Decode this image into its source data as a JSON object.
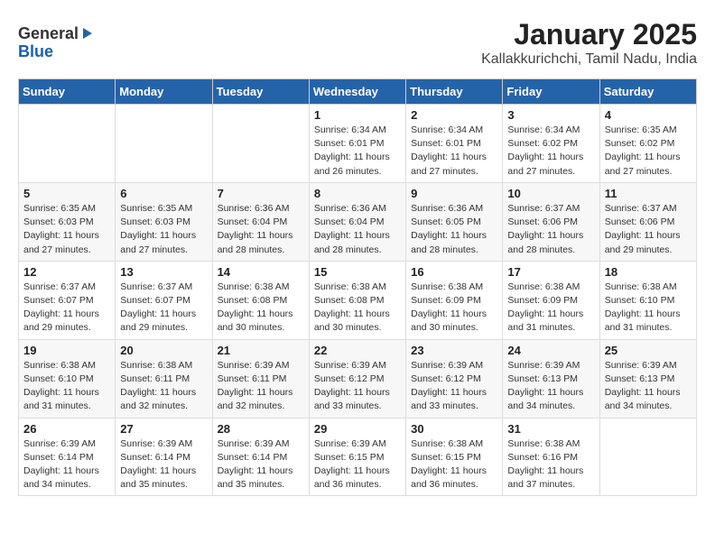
{
  "logo": {
    "general": "General",
    "blue": "Blue"
  },
  "header": {
    "title": "January 2025",
    "subtitle": "Kallakkurichchi, Tamil Nadu, India"
  },
  "weekdays": [
    "Sunday",
    "Monday",
    "Tuesday",
    "Wednesday",
    "Thursday",
    "Friday",
    "Saturday"
  ],
  "weeks": [
    [
      {
        "day": "",
        "info": ""
      },
      {
        "day": "",
        "info": ""
      },
      {
        "day": "",
        "info": ""
      },
      {
        "day": "1",
        "info": "Sunrise: 6:34 AM\nSunset: 6:01 PM\nDaylight: 11 hours\nand 26 minutes."
      },
      {
        "day": "2",
        "info": "Sunrise: 6:34 AM\nSunset: 6:01 PM\nDaylight: 11 hours\nand 27 minutes."
      },
      {
        "day": "3",
        "info": "Sunrise: 6:34 AM\nSunset: 6:02 PM\nDaylight: 11 hours\nand 27 minutes."
      },
      {
        "day": "4",
        "info": "Sunrise: 6:35 AM\nSunset: 6:02 PM\nDaylight: 11 hours\nand 27 minutes."
      }
    ],
    [
      {
        "day": "5",
        "info": "Sunrise: 6:35 AM\nSunset: 6:03 PM\nDaylight: 11 hours\nand 27 minutes."
      },
      {
        "day": "6",
        "info": "Sunrise: 6:35 AM\nSunset: 6:03 PM\nDaylight: 11 hours\nand 27 minutes."
      },
      {
        "day": "7",
        "info": "Sunrise: 6:36 AM\nSunset: 6:04 PM\nDaylight: 11 hours\nand 28 minutes."
      },
      {
        "day": "8",
        "info": "Sunrise: 6:36 AM\nSunset: 6:04 PM\nDaylight: 11 hours\nand 28 minutes."
      },
      {
        "day": "9",
        "info": "Sunrise: 6:36 AM\nSunset: 6:05 PM\nDaylight: 11 hours\nand 28 minutes."
      },
      {
        "day": "10",
        "info": "Sunrise: 6:37 AM\nSunset: 6:06 PM\nDaylight: 11 hours\nand 28 minutes."
      },
      {
        "day": "11",
        "info": "Sunrise: 6:37 AM\nSunset: 6:06 PM\nDaylight: 11 hours\nand 29 minutes."
      }
    ],
    [
      {
        "day": "12",
        "info": "Sunrise: 6:37 AM\nSunset: 6:07 PM\nDaylight: 11 hours\nand 29 minutes."
      },
      {
        "day": "13",
        "info": "Sunrise: 6:37 AM\nSunset: 6:07 PM\nDaylight: 11 hours\nand 29 minutes."
      },
      {
        "day": "14",
        "info": "Sunrise: 6:38 AM\nSunset: 6:08 PM\nDaylight: 11 hours\nand 30 minutes."
      },
      {
        "day": "15",
        "info": "Sunrise: 6:38 AM\nSunset: 6:08 PM\nDaylight: 11 hours\nand 30 minutes."
      },
      {
        "day": "16",
        "info": "Sunrise: 6:38 AM\nSunset: 6:09 PM\nDaylight: 11 hours\nand 30 minutes."
      },
      {
        "day": "17",
        "info": "Sunrise: 6:38 AM\nSunset: 6:09 PM\nDaylight: 11 hours\nand 31 minutes."
      },
      {
        "day": "18",
        "info": "Sunrise: 6:38 AM\nSunset: 6:10 PM\nDaylight: 11 hours\nand 31 minutes."
      }
    ],
    [
      {
        "day": "19",
        "info": "Sunrise: 6:38 AM\nSunset: 6:10 PM\nDaylight: 11 hours\nand 31 minutes."
      },
      {
        "day": "20",
        "info": "Sunrise: 6:38 AM\nSunset: 6:11 PM\nDaylight: 11 hours\nand 32 minutes."
      },
      {
        "day": "21",
        "info": "Sunrise: 6:39 AM\nSunset: 6:11 PM\nDaylight: 11 hours\nand 32 minutes."
      },
      {
        "day": "22",
        "info": "Sunrise: 6:39 AM\nSunset: 6:12 PM\nDaylight: 11 hours\nand 33 minutes."
      },
      {
        "day": "23",
        "info": "Sunrise: 6:39 AM\nSunset: 6:12 PM\nDaylight: 11 hours\nand 33 minutes."
      },
      {
        "day": "24",
        "info": "Sunrise: 6:39 AM\nSunset: 6:13 PM\nDaylight: 11 hours\nand 34 minutes."
      },
      {
        "day": "25",
        "info": "Sunrise: 6:39 AM\nSunset: 6:13 PM\nDaylight: 11 hours\nand 34 minutes."
      }
    ],
    [
      {
        "day": "26",
        "info": "Sunrise: 6:39 AM\nSunset: 6:14 PM\nDaylight: 11 hours\nand 34 minutes."
      },
      {
        "day": "27",
        "info": "Sunrise: 6:39 AM\nSunset: 6:14 PM\nDaylight: 11 hours\nand 35 minutes."
      },
      {
        "day": "28",
        "info": "Sunrise: 6:39 AM\nSunset: 6:14 PM\nDaylight: 11 hours\nand 35 minutes."
      },
      {
        "day": "29",
        "info": "Sunrise: 6:39 AM\nSunset: 6:15 PM\nDaylight: 11 hours\nand 36 minutes."
      },
      {
        "day": "30",
        "info": "Sunrise: 6:38 AM\nSunset: 6:15 PM\nDaylight: 11 hours\nand 36 minutes."
      },
      {
        "day": "31",
        "info": "Sunrise: 6:38 AM\nSunset: 6:16 PM\nDaylight: 11 hours\nand 37 minutes."
      },
      {
        "day": "",
        "info": ""
      }
    ]
  ]
}
